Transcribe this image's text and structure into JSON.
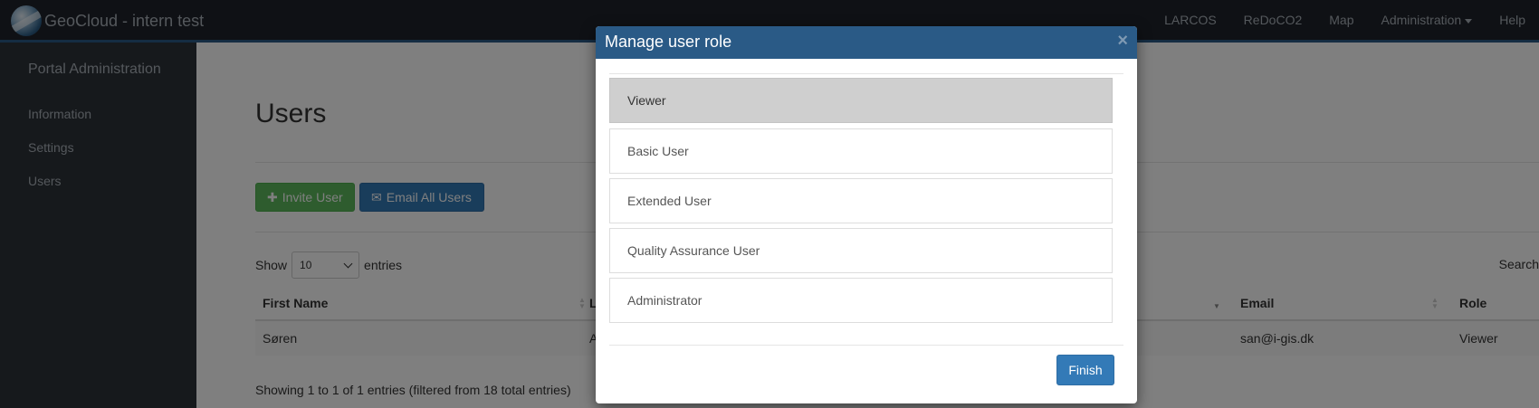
{
  "navbar": {
    "brand": "GeoCloud - intern test",
    "links": [
      {
        "label": "LARCOS"
      },
      {
        "label": "ReDoCO2"
      },
      {
        "label": "Map"
      },
      {
        "label": "Administration"
      },
      {
        "label": "Help"
      }
    ]
  },
  "sidebar": {
    "title": "Portal Administration",
    "items": [
      {
        "label": "Information"
      },
      {
        "label": "Settings"
      },
      {
        "label": "Users"
      }
    ]
  },
  "main": {
    "title": "Users",
    "invite_button": "Invite User",
    "email_button": "Email All Users",
    "show_label": "Show",
    "entries_value": "10",
    "entries_label": "entries",
    "search_label": "Search",
    "columns": [
      "First Name",
      "L",
      "Email",
      "Role"
    ],
    "rows": [
      {
        "first_name": "Søren",
        "last_name": "A",
        "email": "san@i-gis.dk",
        "role": "Viewer"
      }
    ],
    "info": "Showing 1 to 1 of 1 entries (filtered from 18 total entries)"
  },
  "modal": {
    "title": "Manage user role",
    "close": "×",
    "roles": [
      {
        "label": "Viewer",
        "selected": true
      },
      {
        "label": "Basic User",
        "selected": false
      },
      {
        "label": "Extended User",
        "selected": false
      },
      {
        "label": "Quality Assurance User",
        "selected": false
      },
      {
        "label": "Administrator",
        "selected": false
      }
    ],
    "finish_button": "Finish"
  },
  "colors": {
    "navbar_bg": "#1f232a",
    "accent": "#2a5a86",
    "success": "#5cb85c",
    "primary": "#337ab7",
    "sidebar_bg": "#2d3238"
  }
}
